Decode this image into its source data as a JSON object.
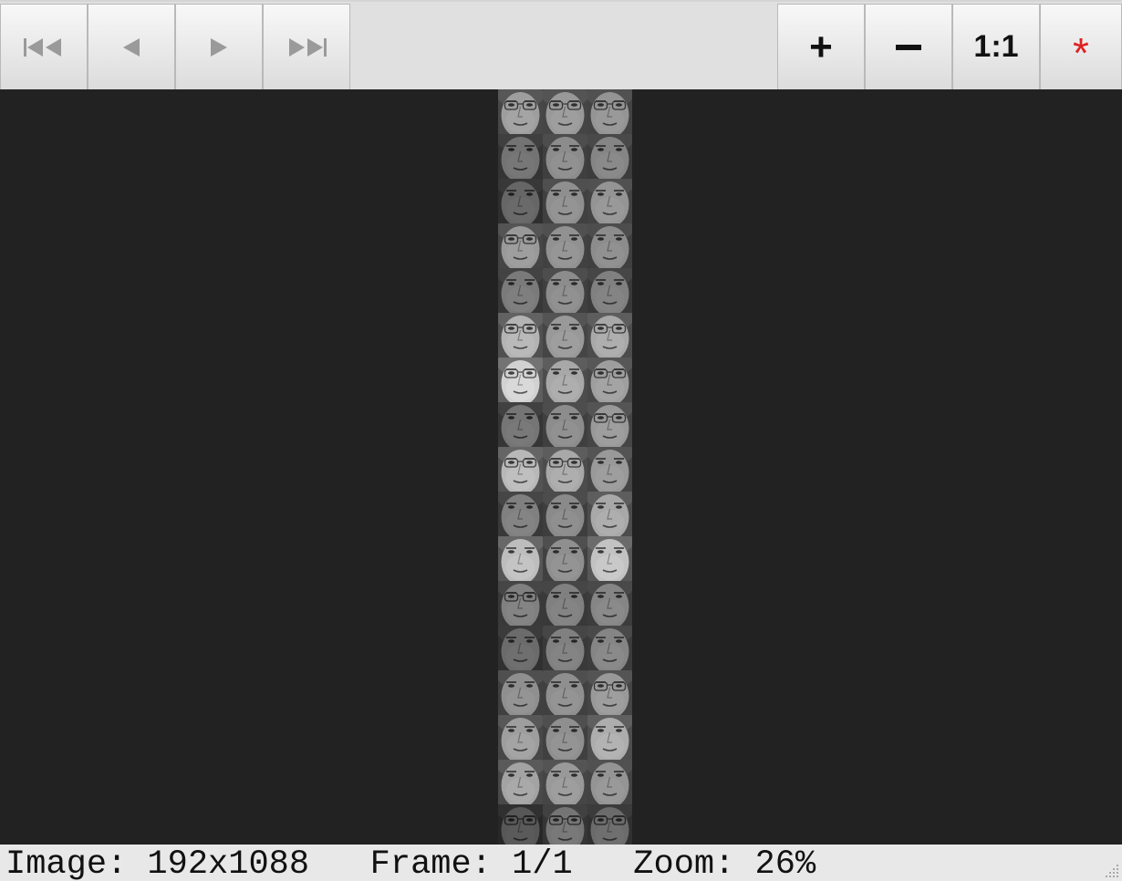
{
  "toolbar": {
    "nav_buttons": [
      {
        "name": "first-frame-button",
        "icon": "skip-to-start-icon"
      },
      {
        "name": "previous-frame-button",
        "icon": "triangle-left-icon"
      },
      {
        "name": "next-frame-button",
        "icon": "triangle-right-icon"
      },
      {
        "name": "last-frame-button",
        "icon": "skip-to-end-icon"
      }
    ],
    "zoom_in_label": "+",
    "zoom_out_icon": "minus-icon",
    "actual_size_label": "1:1",
    "reset_label": "*",
    "reset_color": "#e02020"
  },
  "viewer": {
    "background": "#222222",
    "montage": {
      "columns": 3,
      "rows": 17,
      "tile_tones": [
        [
          0.62,
          0.6,
          0.58
        ],
        [
          0.45,
          0.55,
          0.52
        ],
        [
          0.4,
          0.56,
          0.58
        ],
        [
          0.6,
          0.57,
          0.55
        ],
        [
          0.48,
          0.55,
          0.5
        ],
        [
          0.7,
          0.6,
          0.66
        ],
        [
          0.82,
          0.66,
          0.62
        ],
        [
          0.46,
          0.55,
          0.6
        ],
        [
          0.72,
          0.66,
          0.6
        ],
        [
          0.5,
          0.54,
          0.66
        ],
        [
          0.74,
          0.56,
          0.76
        ],
        [
          0.5,
          0.5,
          0.52
        ],
        [
          0.42,
          0.5,
          0.52
        ],
        [
          0.56,
          0.56,
          0.6
        ],
        [
          0.62,
          0.56,
          0.68
        ],
        [
          0.64,
          0.6,
          0.58
        ],
        [
          0.34,
          0.46,
          0.42
        ]
      ],
      "glasses": [
        [
          true,
          true,
          true
        ],
        [
          false,
          false,
          false
        ],
        [
          false,
          false,
          false
        ],
        [
          true,
          false,
          false
        ],
        [
          false,
          false,
          false
        ],
        [
          true,
          false,
          true
        ],
        [
          true,
          false,
          true
        ],
        [
          false,
          false,
          true
        ],
        [
          true,
          true,
          false
        ],
        [
          false,
          false,
          false
        ],
        [
          false,
          false,
          false
        ],
        [
          true,
          false,
          false
        ],
        [
          false,
          false,
          false
        ],
        [
          false,
          false,
          true
        ],
        [
          false,
          false,
          false
        ],
        [
          false,
          false,
          false
        ],
        [
          true,
          true,
          true
        ]
      ]
    }
  },
  "statusbar": {
    "text": "Image: 192x1088   Frame: 1/1   Zoom: 26%"
  }
}
